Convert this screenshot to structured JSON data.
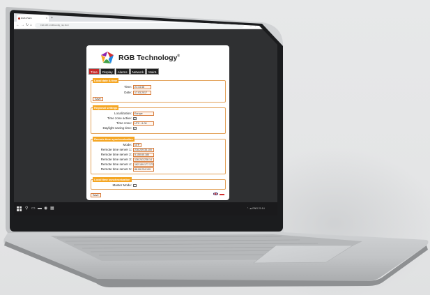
{
  "browser": {
    "tab_title": "RGB RVES",
    "tab_close": "×",
    "new_tab": "+",
    "nav": {
      "back": "←",
      "forward": "→",
      "reload": "↻",
      "home": "⌂"
    },
    "address": "192.168.1.100/config_ntp.html",
    "toolbar_icons": "☆ ⋮ ⊕ ▭"
  },
  "page": {
    "brand": "RGB Technology",
    "brand_mark": "®",
    "tabs": [
      "Time",
      "Display",
      "Alarms",
      "Network",
      "Maint."
    ],
    "active_tab": "Time",
    "local_date_time": {
      "legend": "Local date & time",
      "time_label": "Time:",
      "time_value": "21:14:46",
      "date_label": "Date:",
      "date_value": "17.03.2017",
      "save": "Save"
    },
    "regional": {
      "legend": "Regional settings",
      "localization_label": "Localization:",
      "localization_value": "Europe",
      "tz_active_label": "Time zone active:",
      "tz_active_checked": "✓",
      "tz_label": "Time zone:",
      "tz_value": "UTC +1.00",
      "dst_label": "Daylight saving time:",
      "dst_checked": "✓"
    },
    "remote": {
      "legend": "Remote time synchronization",
      "mode_label": "Mode:",
      "mode_value": "NTP",
      "server1_label": "Remote time server 1:",
      "server1_value": "216.239.35.100",
      "server2_label": "Remote time server 2:",
      "server2_value": "5.150.60.180",
      "server3_label": "Remote time server 3:",
      "server3_value": "136.243.238.14",
      "server4_label": "Remote time server 4:",
      "server4_value": "162.159.177.173",
      "server5_label": "Remote time server 5:",
      "server5_value": "88.99.224.109"
    },
    "local_sync": {
      "legend": "Local time synchronization",
      "master_label": "Master Mode:"
    },
    "save_button": "Save"
  },
  "taskbar": {
    "start_icon": "windows-logo",
    "icons": [
      "⚲",
      "▭",
      "▬",
      "◉",
      "▦"
    ],
    "tray": "⌃ ☁ ENG 21:14"
  },
  "colors": {
    "accent_orange": "#f5a623",
    "input_border": "#d77b3a",
    "active_tab": "#c62828",
    "tab_bg": "#1e1e1e"
  }
}
